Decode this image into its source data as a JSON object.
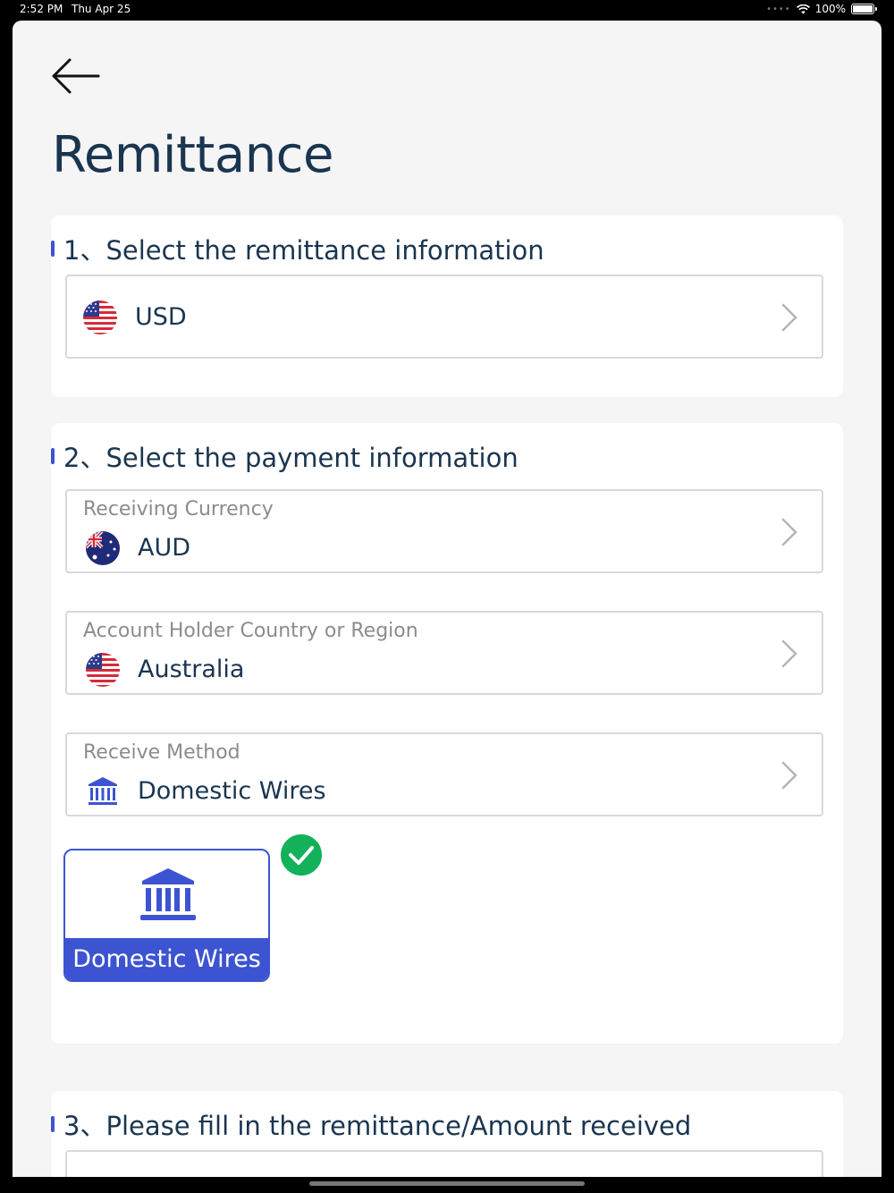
{
  "status_bar": {
    "time": "2:52 PM",
    "date": "Thu Apr 25",
    "battery": "100%"
  },
  "page": {
    "title": "Remittance"
  },
  "section1": {
    "title": "1、Select the remittance information",
    "currency": {
      "value": "USD",
      "flag": "us-flag-icon"
    }
  },
  "section2": {
    "title": "2、Select the payment information",
    "receiving_currency": {
      "caption": "Receiving Currency",
      "value": "AUD",
      "flag": "au-flag-icon"
    },
    "holder_country": {
      "caption": "Account Holder Country or Region",
      "value": "Australia",
      "flag": "us-flag-icon"
    },
    "receive_method": {
      "caption": "Receive Method",
      "value": "Domestic Wires",
      "icon": "bank-icon"
    },
    "method_options": [
      {
        "label": "Domestic Wires",
        "icon": "bank-icon",
        "selected": true
      }
    ]
  },
  "section3": {
    "title": "3、Please fill in the remittance/Amount received"
  },
  "colors": {
    "accent": "#3c54d1",
    "title": "#1a3550",
    "success": "#12b15a",
    "background": "#f5f5f5"
  }
}
